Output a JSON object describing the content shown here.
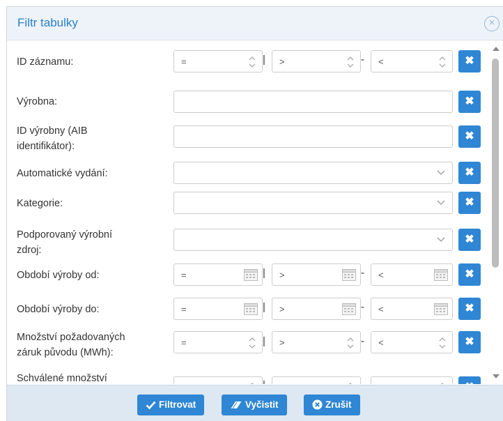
{
  "dialog": {
    "title": "Filtr tabulky",
    "close_icon": "close-circle-icon"
  },
  "fields": {
    "record_id": {
      "label": "ID záznamu:",
      "eq": "=",
      "gt": ">",
      "lt": "<"
    },
    "plant": {
      "label": "Výrobna:"
    },
    "plant_id": {
      "label_line1": "ID výrobny (AIB",
      "label_line2": "identifikátor):"
    },
    "auto_release": {
      "label": "Automatické vydání:"
    },
    "category": {
      "label": "Kategorie:"
    },
    "supported_source": {
      "label_line1": "Podporovaný výrobní",
      "label_line2": "zdroj:"
    },
    "period_from": {
      "label": "Období výroby od:",
      "eq": "=",
      "gt": ">",
      "lt": "<"
    },
    "period_to": {
      "label": "Období výroby do:",
      "eq": "=",
      "gt": ">",
      "lt": "<"
    },
    "requested_qty": {
      "label_line1": "Množství požadovaných",
      "label_line2": "záruk původu (MWh):",
      "eq": "=",
      "gt": ">",
      "lt": "<"
    },
    "approved_qty": {
      "label": "Schválené množství",
      "eq": "=",
      "gt": ">",
      "lt": "<"
    }
  },
  "separators": {
    "pipe": "|",
    "dash": "-"
  },
  "clear_icon": "x-icon",
  "footer": {
    "filter_label": "Filtrovat",
    "clear_label": "Vyčistit",
    "cancel_label": "Zrušit"
  },
  "colors": {
    "accent": "#2f86d4",
    "header_bg": "#edf3f9",
    "footer_bg": "#dde8f2",
    "title": "#2a7fc6"
  }
}
